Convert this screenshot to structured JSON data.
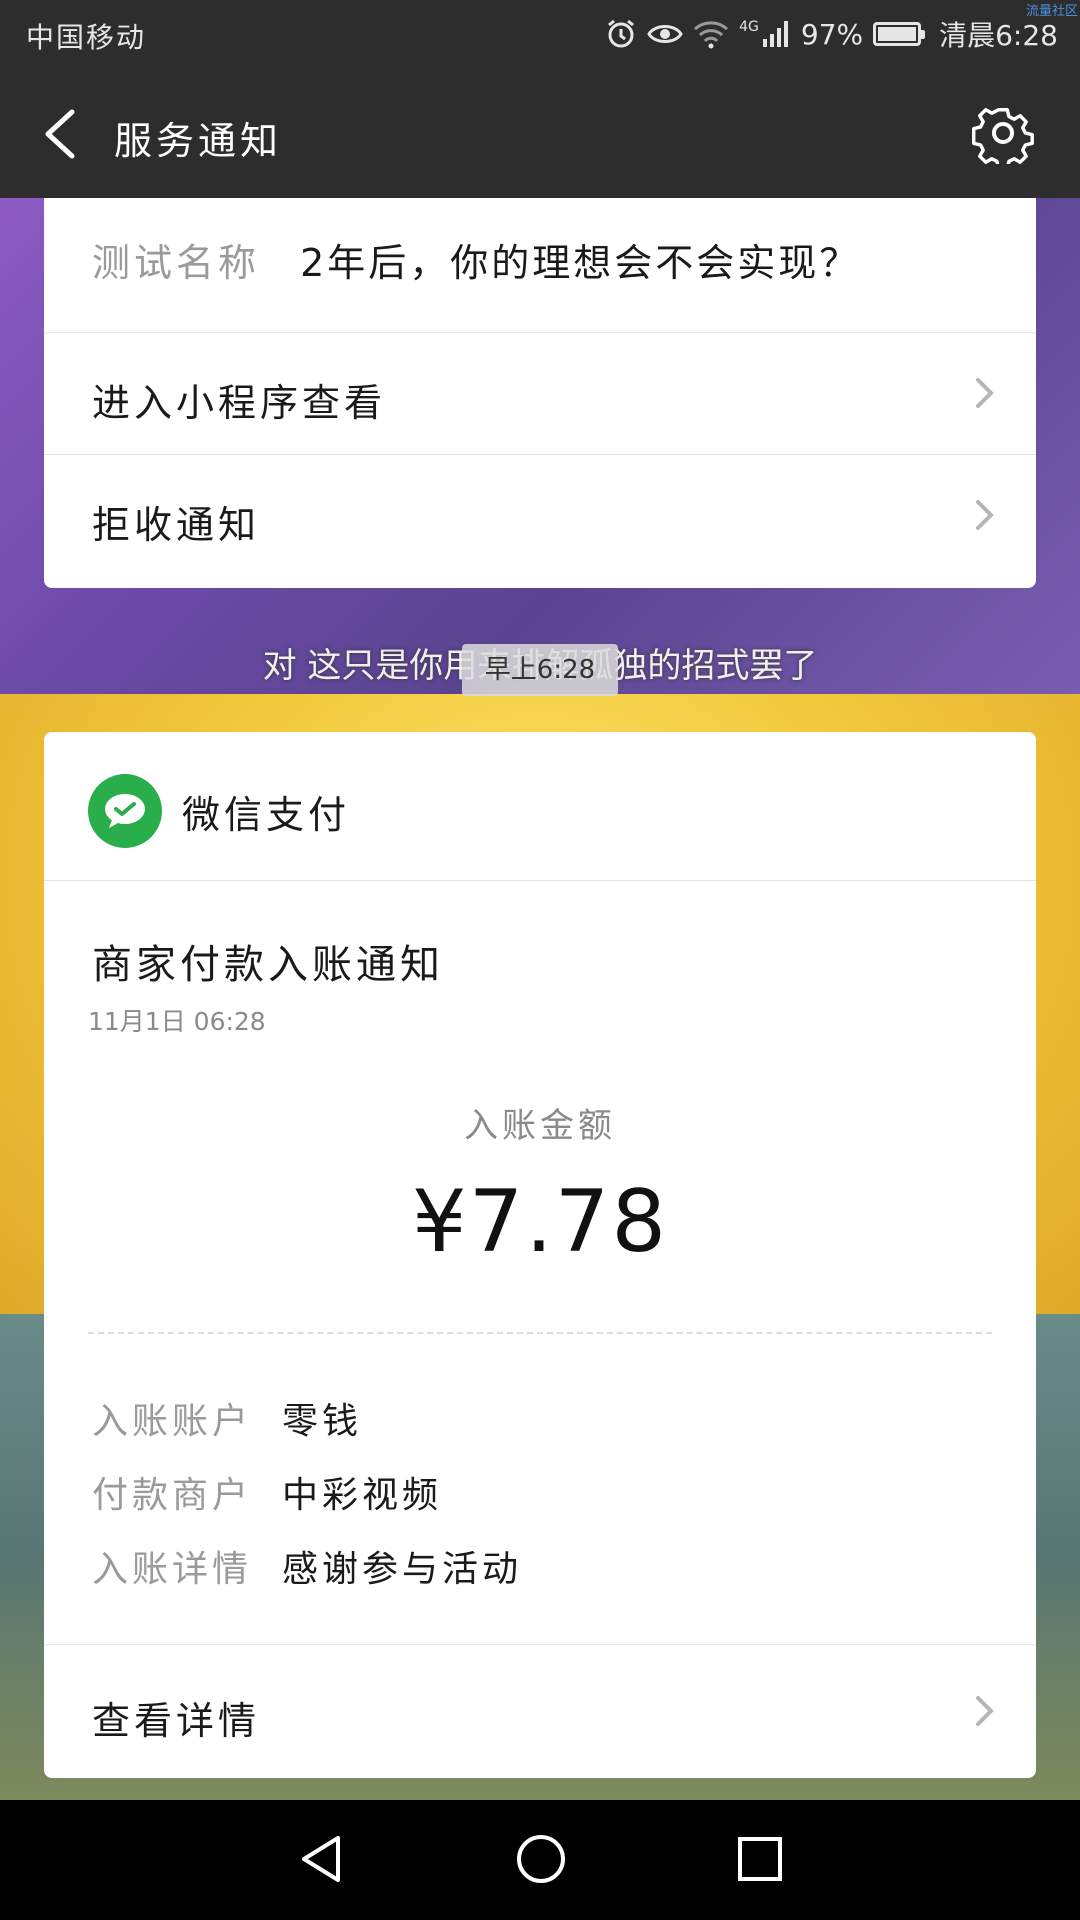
{
  "status_bar": {
    "carrier": "中国移动",
    "network": "4G",
    "battery": "97%",
    "battery_level": 0.97,
    "time": "清晨6:28",
    "watermark": "流量社区"
  },
  "nav": {
    "title": "服务通知"
  },
  "top_card": {
    "test_label": "测试名称",
    "test_value": "2年后，你的理想会不会实现？",
    "open_miniprogram": "进入小程序查看",
    "reject_notifications": "拒收通知"
  },
  "video_subtitle": "对 这只是你用来排解孤独的招式罢了",
  "timestamp_chip": "早上6:28",
  "pay_card": {
    "brand": "微信支付",
    "title": "商家付款入账通知",
    "time": "11月1日  06:28",
    "amount_label": "入账金额",
    "amount": "¥7.78",
    "details": [
      {
        "key": "入账账户",
        "value": "零钱"
      },
      {
        "key": "付款商户",
        "value": "中彩视频"
      },
      {
        "key": "入账详情",
        "value": "感谢参与活动"
      }
    ],
    "view_details": "查看详情"
  }
}
